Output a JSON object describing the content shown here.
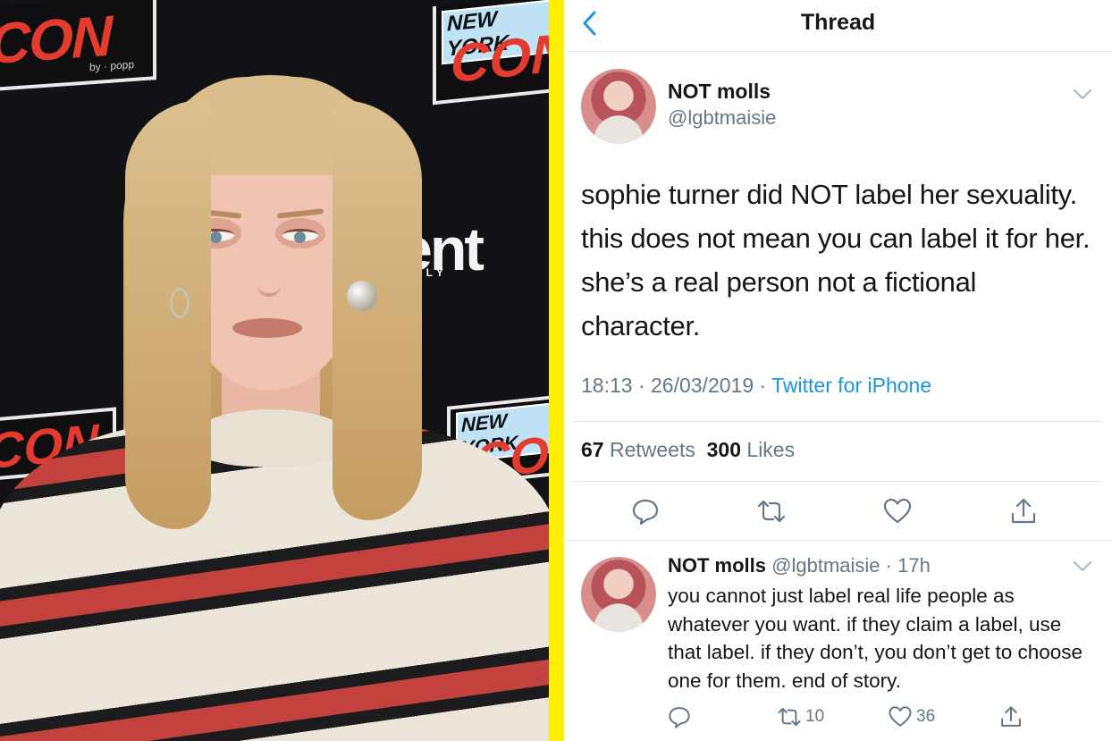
{
  "photo": {
    "backdrop_texts": {
      "con_left": "CON",
      "ny_top": "NEW YORK",
      "con_top": "CON",
      "con_mid": "CON",
      "ny_mid": "NEW YORK",
      "con_mid_right": "CO",
      "ew": "ent",
      "ew_sub": "EKLY",
      "by_line": "by · popp"
    }
  },
  "nav": {
    "title": "Thread",
    "back_icon": "chevron-left-icon"
  },
  "tweet": {
    "author_name": "NOT molls",
    "author_handle": "@lgbtmaisie",
    "text": "sophie turner did NOT label her sexuality. this does not mean you can label it for her. she’s a real person not a fictional character.",
    "time": "18:13 · 26/03/2019 · ",
    "source": "Twitter for iPhone",
    "retweets_count": "67",
    "retweets_label": "Retweets",
    "likes_count": "300",
    "likes_label": "Likes",
    "actions": [
      "reply-icon",
      "retweet-icon",
      "like-icon",
      "share-icon"
    ]
  },
  "reply": {
    "author_name": "NOT molls",
    "author_handle": "@lgbtmaisie",
    "time": "· 17h",
    "text": "you cannot just label real life people as whatever you want. if they claim a label, use that label. if they don’t, you don’t get to choose one for them. end of story.",
    "retweets": "10",
    "likes": "36"
  },
  "colors": {
    "divider": "#ffef00",
    "link": "#1b95e0",
    "secondary": "#657786",
    "border": "#e1e8ed"
  }
}
